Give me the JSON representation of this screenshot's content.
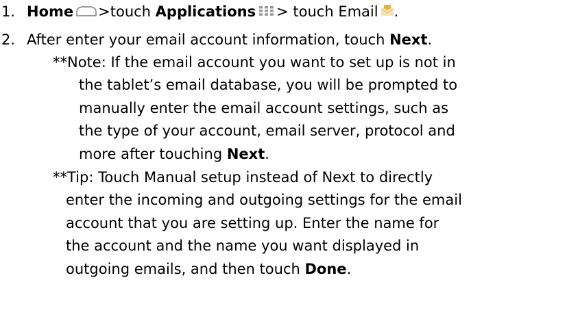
{
  "icons": {
    "home": "home-icon",
    "applications": "applications-icon",
    "email": "email-icon"
  },
  "steps": [
    {
      "number": "1.",
      "home": "Home",
      "after_home": ">touch",
      "applications": "Applications",
      "after_applications": "> touch Email"
    },
    {
      "number": "2.",
      "text": "After enter your email account information, touch",
      "next": "Next",
      "end": "."
    }
  ],
  "note": {
    "line1": "**Note: If the email account you want to set up is not in",
    "line2": "the tablet’s email database, you will be prompted to",
    "line3": "manually enter the email account settings, such as",
    "line4": "the type of your account, email server, protocol and",
    "line5_pre": "more after touching",
    "line5_bold": "Next",
    "line5_end": "."
  },
  "tip": {
    "line1": "**Tip: Touch Manual setup instead of Next to directly",
    "line2": "enter the incoming and outgoing settings for the email",
    "line3": "account that you are setting up. Enter the name for",
    "line4": "the account and the name you want displayed in",
    "line5_pre": "outgoing emails, and then touch",
    "line5_bold": "Done",
    "line5_end": "."
  }
}
